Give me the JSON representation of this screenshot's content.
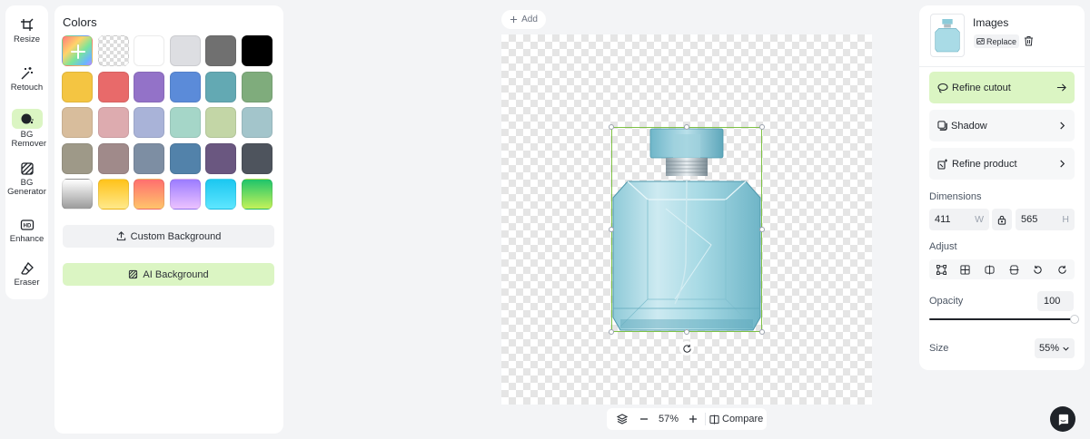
{
  "sidebar": {
    "tools": [
      {
        "label": "Resize",
        "icon": "crop-icon"
      },
      {
        "label": "Retouch",
        "icon": "magic-wand-icon"
      },
      {
        "label": "BG Remover",
        "icon": "bg-remover-icon",
        "active": true
      },
      {
        "label": "BG Generator",
        "icon": "bg-generator-icon"
      },
      {
        "label": "Enhance",
        "icon": "hd-icon"
      },
      {
        "label": "Eraser",
        "icon": "eraser-icon"
      }
    ]
  },
  "colors_panel": {
    "title": "Colors",
    "swatches": [
      "add",
      "transparent",
      "#ffffff",
      "#dddee2",
      "#707070",
      "#000000",
      "#f4c542",
      "#e86a6a",
      "#9372c8",
      "#5b8bd9",
      "#63a9b3",
      "#7fac7c",
      "#d8bd9c",
      "#ddabaf",
      "#a9b3d8",
      "#a5d6c8",
      "#c3d6a6",
      "#a3c5cb",
      "#9e9988",
      "#a08a8a",
      "#7d8ea3",
      "#5282aa",
      "#6a5780",
      "#4e545d",
      "grad-gray",
      "grad-yellow",
      "grad-red",
      "grad-purple",
      "grad-cyan",
      "grad-green"
    ],
    "custom_background_label": "Custom Background",
    "ai_background_label": "AI Background"
  },
  "canvas": {
    "add_label": "Add",
    "zoom_level": "57%",
    "compare_label": "Compare"
  },
  "right_panel": {
    "title": "Images",
    "replace_label": "Replace",
    "options": {
      "refine_cutout": "Refine cutout",
      "shadow": "Shadow",
      "refine_product": "Refine product"
    },
    "dimensions_label": "Dimensions",
    "width_value": "411",
    "width_unit": "W",
    "height_value": "565",
    "height_unit": "H",
    "adjust_label": "Adjust",
    "opacity_label": "Opacity",
    "opacity_value": "100",
    "opacity_level": 1.0,
    "size_label": "Size",
    "size_value": "55%"
  },
  "colors": {
    "accent": "#dbf5c3",
    "selection": "#7ec144"
  }
}
